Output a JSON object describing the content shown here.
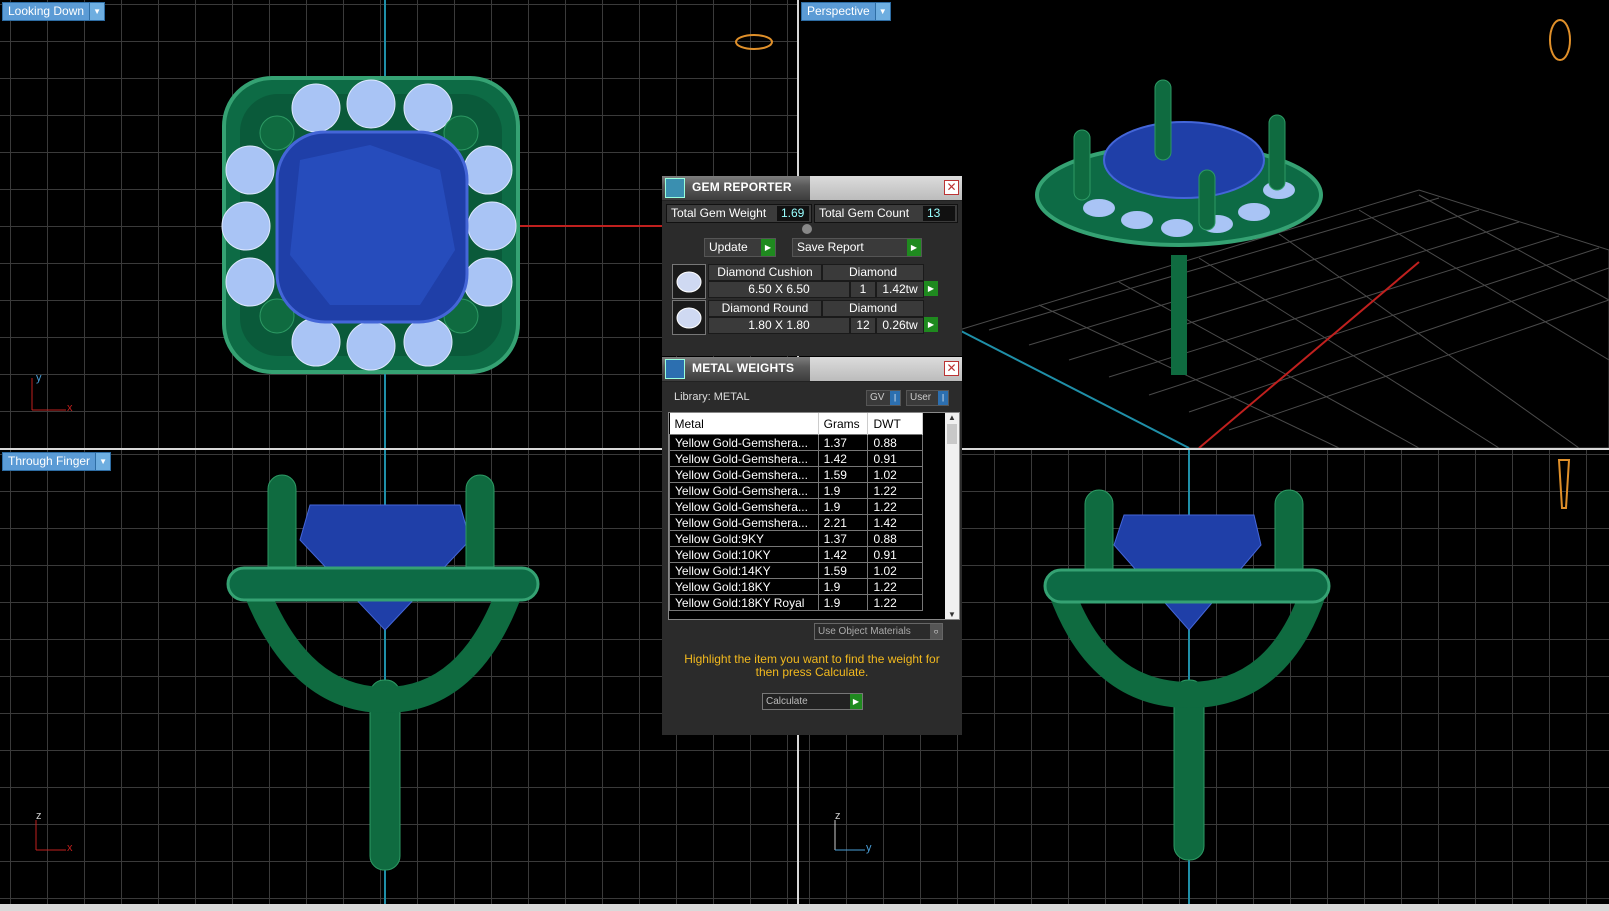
{
  "viewports": {
    "top_left": {
      "label": "Looking Down",
      "axes": [
        "y",
        "x"
      ]
    },
    "top_right": {
      "label": "Perspective"
    },
    "bottom_left": {
      "label": "Through Finger",
      "axes": [
        "z",
        "x"
      ]
    },
    "bottom_right": {
      "axes": [
        "z",
        "y"
      ]
    }
  },
  "gem_reporter": {
    "title": "GEM REPORTER",
    "total_weight_label": "Total Gem Weight",
    "total_weight_value": "1.69",
    "total_count_label": "Total Gem Count",
    "total_count_value": "13",
    "update_label": "Update",
    "save_report_label": "Save Report",
    "gems": [
      {
        "name": "Diamond Cushion",
        "material": "Diamond",
        "size": "6.50 X 6.50",
        "count": "1",
        "weight": "1.42tw"
      },
      {
        "name": "Diamond Round",
        "material": "Diamond",
        "size": "1.80 X 1.80",
        "count": "12",
        "weight": "0.26tw"
      }
    ]
  },
  "metal_weights": {
    "title": "METAL WEIGHTS",
    "library_label": "Library: METAL",
    "gv_label": "GV",
    "user_label": "User",
    "columns": [
      "Metal",
      "Grams",
      "DWT"
    ],
    "rows": [
      [
        "Yellow Gold-Gemshera...",
        "1.37",
        "0.88"
      ],
      [
        "Yellow Gold-Gemshera...",
        "1.42",
        "0.91"
      ],
      [
        "Yellow Gold-Gemshera...",
        "1.59",
        "1.02"
      ],
      [
        "Yellow Gold-Gemshera...",
        "1.9",
        "1.22"
      ],
      [
        "Yellow Gold-Gemshera...",
        "1.9",
        "1.22"
      ],
      [
        "Yellow Gold-Gemshera...",
        "2.21",
        "1.42"
      ],
      [
        "Yellow Gold:9KY",
        "1.37",
        "0.88"
      ],
      [
        "Yellow Gold:10KY",
        "1.42",
        "0.91"
      ],
      [
        "Yellow Gold:14KY",
        "1.59",
        "1.02"
      ],
      [
        "Yellow Gold:18KY",
        "1.9",
        "1.22"
      ],
      [
        "Yellow Gold:18KY Royal",
        "1.9",
        "1.22"
      ]
    ],
    "use_object_materials_label": "Use Object Materials",
    "hint": "Highlight the item you want to find the weight for then press Calculate.",
    "calculate_label": "Calculate"
  }
}
